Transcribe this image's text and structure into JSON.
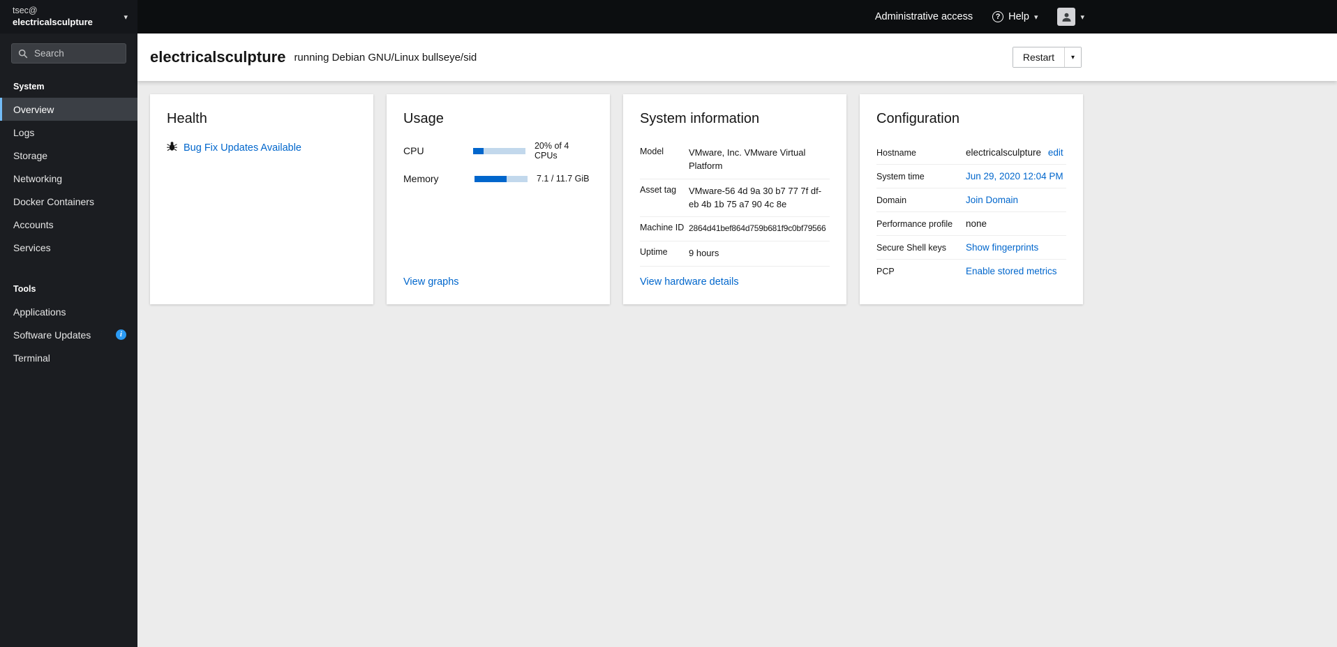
{
  "colors": {
    "link_blue": "#0066cc",
    "progress_fill": "#0066cc",
    "active_nav_border": "#73bcf7",
    "info_badge_blue": "#2b9af3",
    "sidebar_bg": "#1b1d21",
    "topbar_bg": "#0c0e10"
  },
  "icons": {
    "caret_down": "▾",
    "question_mark": "?",
    "info_glyph": "i"
  },
  "sidebar": {
    "user": "tsec@",
    "host": "electricalsculpture",
    "search_placeholder": "Search",
    "sections": [
      {
        "title": "System",
        "items": [
          {
            "label": "Overview",
            "active": true
          },
          {
            "label": "Logs"
          },
          {
            "label": "Storage"
          },
          {
            "label": "Networking"
          },
          {
            "label": "Docker Containers"
          },
          {
            "label": "Accounts"
          },
          {
            "label": "Services"
          }
        ]
      },
      {
        "title": "Tools",
        "items": [
          {
            "label": "Applications"
          },
          {
            "label": "Software Updates",
            "badge": "info"
          },
          {
            "label": "Terminal"
          }
        ]
      }
    ]
  },
  "topbar": {
    "administrative_access": "Administrative access",
    "help_label": "Help"
  },
  "header": {
    "hostname": "electricalsculpture",
    "os_text": "running Debian GNU/Linux bullseye/sid",
    "restart_label": "Restart"
  },
  "health": {
    "title": "Health",
    "update_link": "Bug Fix Updates Available"
  },
  "usage": {
    "title": "Usage",
    "rows": [
      {
        "label": "CPU",
        "percent": 20,
        "value": "20% of 4 CPUs"
      },
      {
        "label": "Memory",
        "percent": 61,
        "value": "7.1 / 11.7 GiB"
      }
    ],
    "view_graphs_link": "View graphs"
  },
  "system_information": {
    "title": "System information",
    "rows": [
      {
        "label": "Model",
        "value": "VMware, Inc. VMware Virtual Platform"
      },
      {
        "label": "Asset tag",
        "value": "VMware-56 4d 9a 30 b7 77 7f df-eb 4b 1b 75 a7 90 4c 8e"
      },
      {
        "label": "Machine ID",
        "value": "2864d41bef864d759b681f9c0bf79566"
      },
      {
        "label": "Uptime",
        "value": "9 hours"
      }
    ],
    "details_link": "View hardware details"
  },
  "configuration": {
    "title": "Configuration",
    "rows": [
      {
        "label": "Hostname",
        "value": "electricalsculpture",
        "link": "edit"
      },
      {
        "label": "System time",
        "link": "Jun 29, 2020 12:04 PM"
      },
      {
        "label": "Domain",
        "link": "Join Domain"
      },
      {
        "label": "Performance profile",
        "value": "none"
      },
      {
        "label": "Secure Shell keys",
        "link": "Show fingerprints"
      },
      {
        "label": "PCP",
        "link": "Enable stored metrics"
      }
    ]
  }
}
